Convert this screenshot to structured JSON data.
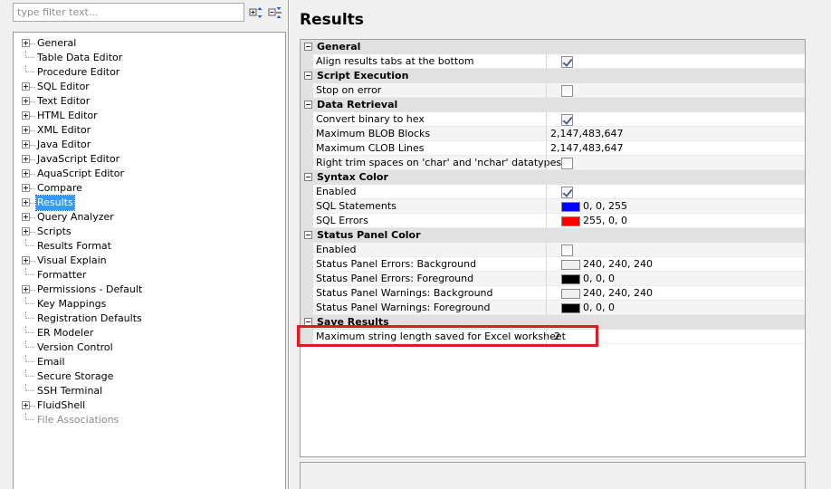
{
  "filter": {
    "placeholder": "type filter text..."
  },
  "toolbar": {
    "expand_icon": "expand-all-icon",
    "collapse_icon": "collapse-all-icon"
  },
  "tree": {
    "items": [
      {
        "label": "General",
        "expandable": true
      },
      {
        "label": "Table Data Editor",
        "expandable": false
      },
      {
        "label": "Procedure Editor",
        "expandable": false
      },
      {
        "label": "SQL Editor",
        "expandable": true
      },
      {
        "label": "Text Editor",
        "expandable": true
      },
      {
        "label": "HTML Editor",
        "expandable": true
      },
      {
        "label": "XML Editor",
        "expandable": true
      },
      {
        "label": "Java Editor",
        "expandable": true
      },
      {
        "label": "JavaScript Editor",
        "expandable": true
      },
      {
        "label": "AquaScript Editor",
        "expandable": true
      },
      {
        "label": "Compare",
        "expandable": true
      },
      {
        "label": "Results",
        "expandable": true,
        "selected": true
      },
      {
        "label": "Query Analyzer",
        "expandable": true
      },
      {
        "label": "Scripts",
        "expandable": true
      },
      {
        "label": "Results Format",
        "expandable": false
      },
      {
        "label": "Visual Explain",
        "expandable": true
      },
      {
        "label": "Formatter",
        "expandable": false
      },
      {
        "label": "Permissions - Default",
        "expandable": true
      },
      {
        "label": "Key Mappings",
        "expandable": false
      },
      {
        "label": "Registration Defaults",
        "expandable": false
      },
      {
        "label": "ER Modeler",
        "expandable": false
      },
      {
        "label": "Version Control",
        "expandable": false
      },
      {
        "label": "Email",
        "expandable": false
      },
      {
        "label": "Secure Storage",
        "expandable": false
      },
      {
        "label": "SSH Terminal",
        "expandable": false
      },
      {
        "label": "FluidShell",
        "expandable": true
      },
      {
        "label": "File Associations",
        "expandable": false,
        "disabled": true
      }
    ]
  },
  "page": {
    "title": "Results"
  },
  "grid": {
    "rows": [
      {
        "kind": "category",
        "label": "General"
      },
      {
        "kind": "prop",
        "name": "Align results tabs at the bottom",
        "type": "checkbox",
        "checked": true
      },
      {
        "kind": "category",
        "label": "Script Execution"
      },
      {
        "kind": "prop",
        "name": "Stop on error",
        "type": "checkbox",
        "checked": false
      },
      {
        "kind": "category",
        "label": "Data Retrieval"
      },
      {
        "kind": "prop",
        "name": "Convert binary to hex",
        "type": "checkbox",
        "checked": true
      },
      {
        "kind": "prop",
        "name": "Maximum BLOB Blocks",
        "type": "text",
        "value": "2,147,483,647"
      },
      {
        "kind": "prop",
        "name": "Maximum CLOB Lines",
        "type": "text",
        "value": "2,147,483,647"
      },
      {
        "kind": "prop",
        "name": "Right trim spaces on 'char' and 'nchar' datatypes",
        "type": "checkbox",
        "checked": false
      },
      {
        "kind": "category",
        "label": "Syntax Color"
      },
      {
        "kind": "prop",
        "name": "Enabled",
        "type": "checkbox",
        "checked": true
      },
      {
        "kind": "prop",
        "name": "SQL Statements",
        "type": "color",
        "value": "0, 0, 255",
        "color": "#0000ff"
      },
      {
        "kind": "prop",
        "name": "SQL Errors",
        "type": "color",
        "value": "255, 0, 0",
        "color": "#ff0000"
      },
      {
        "kind": "category",
        "label": "Status Panel Color"
      },
      {
        "kind": "prop",
        "name": "Enabled",
        "type": "checkbox",
        "checked": false
      },
      {
        "kind": "prop",
        "name": "Status Panel Errors: Background",
        "type": "color",
        "value": "240, 240, 240",
        "color": "#f0f0f0"
      },
      {
        "kind": "prop",
        "name": "Status Panel Errors: Foreground",
        "type": "color",
        "value": "0, 0, 0",
        "color": "#000000"
      },
      {
        "kind": "prop",
        "name": "Status Panel Warnings: Background",
        "type": "color",
        "value": "240, 240, 240",
        "color": "#f0f0f0"
      },
      {
        "kind": "prop",
        "name": "Status Panel Warnings: Foreground",
        "type": "color",
        "value": "0, 0, 0",
        "color": "#000000"
      },
      {
        "kind": "category",
        "label": "Save Results"
      },
      {
        "kind": "prop",
        "name": "Maximum string length saved for Excel worksheet",
        "type": "text",
        "value": "-2",
        "highlighted": true
      }
    ]
  },
  "colors": {
    "selection": "#3399ff",
    "highlight": "#e01b24",
    "category_bg": "#e1e1e1"
  }
}
